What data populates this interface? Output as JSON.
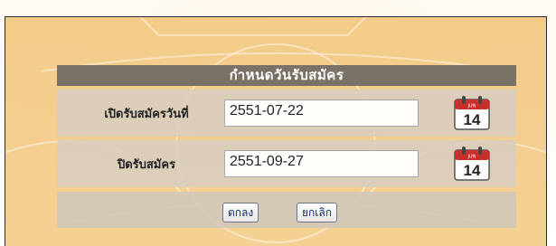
{
  "form": {
    "title": "กำหนดวันรับสมัคร",
    "open_label": "เปิดรับสมัครวันที่",
    "open_value": "2551-07-22",
    "close_label": "ปิดรับสมัคร",
    "close_value": "2551-09-27",
    "calendar_day": "14",
    "calendar_month": "JUN",
    "ok_label": "ตกลง",
    "cancel_label": "ยกเลิก"
  },
  "colors": {
    "header_bg": "#7a7167",
    "panel_bg": "#f3c984",
    "calendar_red": "#c8312b"
  }
}
